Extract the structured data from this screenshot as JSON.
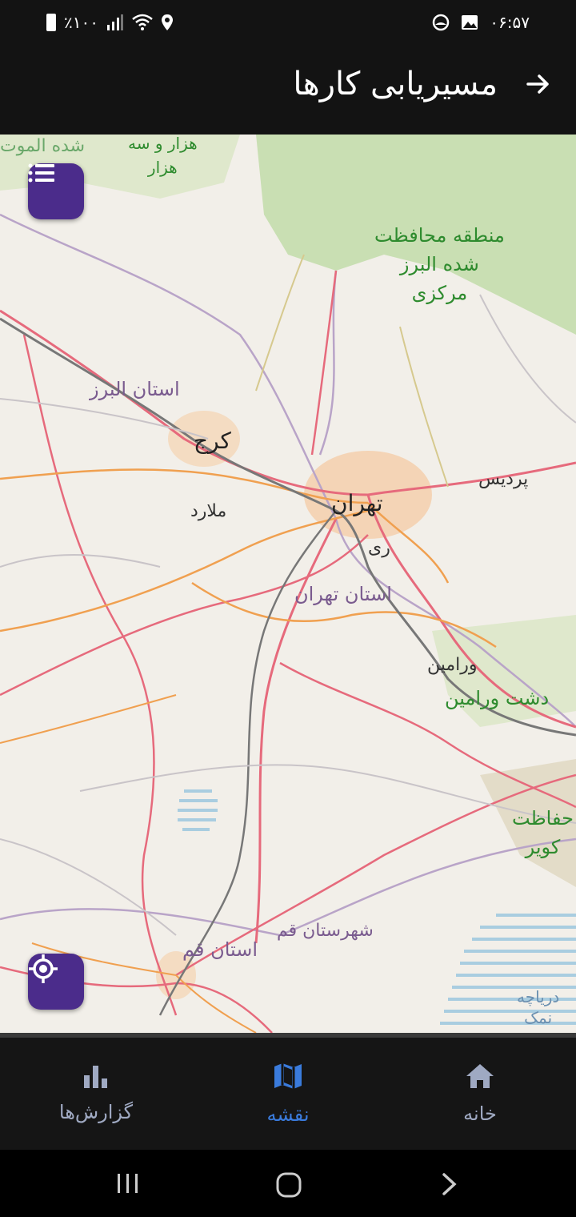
{
  "status": {
    "battery": "٪۱۰۰",
    "time": "۰۶:۵۷"
  },
  "appbar": {
    "title": "مسیریابی کارها",
    "back_icon": "arrow-right-icon"
  },
  "map": {
    "labels": {
      "tehran": "تهران",
      "karaj": "کرج",
      "malard": "ملارد",
      "rey": "ری",
      "pardis": "پردیس",
      "varamin": "ورامین",
      "dasht_varamin": "دشت ورامین",
      "alborz_province": "استان البرز",
      "tehran_province": "استان تهران",
      "qom_province": "استان قم",
      "qom_county": "شهرستان قم",
      "protected_area_line1": "منطقه محافظت",
      "protected_area_line2": "شده البرز",
      "protected_area_line3": "مرکزی",
      "hezar_line1": "هزار و سه",
      "hezar_line2": "هزار",
      "top_left_partial": "شده الموت",
      "kavir_line1": "حفاظت",
      "kavir_line2": "کویر",
      "lake_line1": "دریاچه",
      "lake_line2": "نمک"
    }
  },
  "fabs": {
    "layers_icon": "list-icon",
    "locate_icon": "crosshair-icon"
  },
  "nav": {
    "reports": "گزارش‌ها",
    "map": "نقشه",
    "home": "خانه"
  },
  "colors": {
    "accent": "#4b2c8b",
    "nav_active": "#3a7bdc",
    "nav_inactive": "#9fa9c2"
  }
}
